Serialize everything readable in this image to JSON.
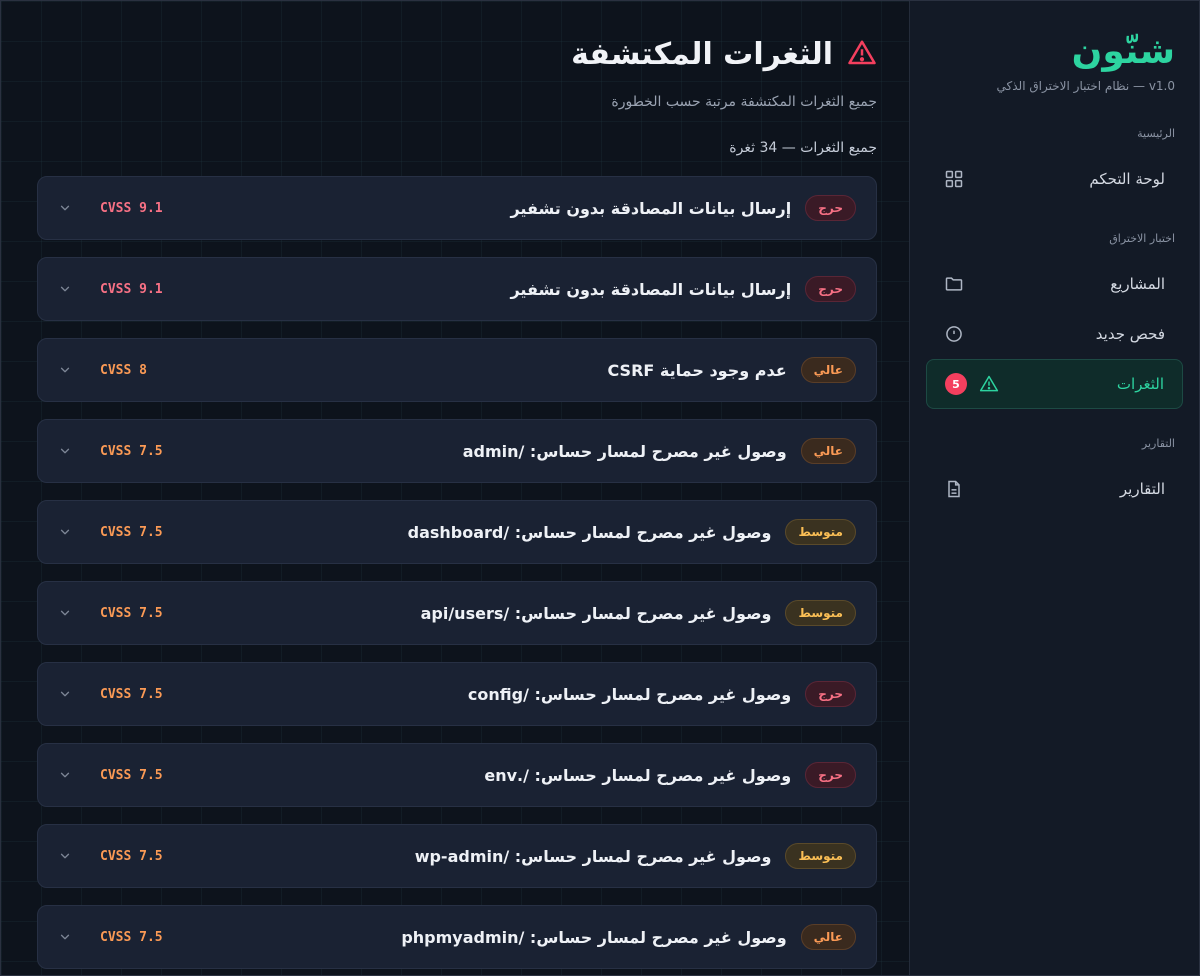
{
  "brand": {
    "name": "شنّون",
    "subtitle": "v1.0 — نظام اختبار الاختراق الذكي"
  },
  "sidebar": {
    "sections": [
      {
        "label": "الرئيسية",
        "items": [
          {
            "label": "لوحة التحكم",
            "icon": "grid-icon"
          }
        ]
      },
      {
        "label": "اختبار الاختراق",
        "items": [
          {
            "label": "المشاريع",
            "icon": "folder-icon"
          },
          {
            "label": "فحص جديد",
            "icon": "circle-icon"
          },
          {
            "label": "الثغرات",
            "icon": "warning-icon",
            "badge": "5",
            "active": true
          }
        ]
      },
      {
        "label": "التقارير",
        "items": [
          {
            "label": "التقارير",
            "icon": "document-icon"
          }
        ]
      }
    ]
  },
  "main": {
    "title": "الثغرات المكتشفة",
    "subtitle": "جميع الثغرات المكتشفة مرتبة حسب الخطورة",
    "count_line": "جميع الثغرات — 34 ثغرة",
    "vulns": [
      {
        "severity": "critical",
        "severity_label": "حرج",
        "title": "إرسال بيانات المصادقة بدون تشفير",
        "cvss": "CVSS 9.1",
        "cvss_level": "critical"
      },
      {
        "severity": "critical",
        "severity_label": "حرج",
        "title": "إرسال بيانات المصادقة بدون تشفير",
        "cvss": "CVSS 9.1",
        "cvss_level": "critical"
      },
      {
        "severity": "high",
        "severity_label": "عالي",
        "title": "عدم وجود حماية CSRF",
        "cvss": "CVSS 8",
        "cvss_level": "high"
      },
      {
        "severity": "high",
        "severity_label": "عالي",
        "title": "وصول غير مصرح لمسار حساس: /admin",
        "cvss": "CVSS 7.5",
        "cvss_level": "high"
      },
      {
        "severity": "medium",
        "severity_label": "متوسط",
        "title": "وصول غير مصرح لمسار حساس: /dashboard",
        "cvss": "CVSS 7.5",
        "cvss_level": "high"
      },
      {
        "severity": "medium",
        "severity_label": "متوسط",
        "title": "وصول غير مصرح لمسار حساس: /api/users",
        "cvss": "CVSS 7.5",
        "cvss_level": "high"
      },
      {
        "severity": "critical",
        "severity_label": "حرج",
        "title": "وصول غير مصرح لمسار حساس: /config",
        "cvss": "CVSS 7.5",
        "cvss_level": "high"
      },
      {
        "severity": "critical",
        "severity_label": "حرج",
        "title": "وصول غير مصرح لمسار حساس: /.env",
        "cvss": "CVSS 7.5",
        "cvss_level": "high"
      },
      {
        "severity": "medium",
        "severity_label": "متوسط",
        "title": "وصول غير مصرح لمسار حساس: /wp-admin",
        "cvss": "CVSS 7.5",
        "cvss_level": "high"
      },
      {
        "severity": "high",
        "severity_label": "عالي",
        "title": "وصول غير مصرح لمسار حساس: /phpmyadmin",
        "cvss": "CVSS 7.5",
        "cvss_level": "high"
      }
    ]
  },
  "colors": {
    "accent": "#2dd4a0",
    "critical": "#f87185",
    "high": "#fb9a55",
    "medium": "#fbbf55",
    "badge": "#f43f5e"
  }
}
